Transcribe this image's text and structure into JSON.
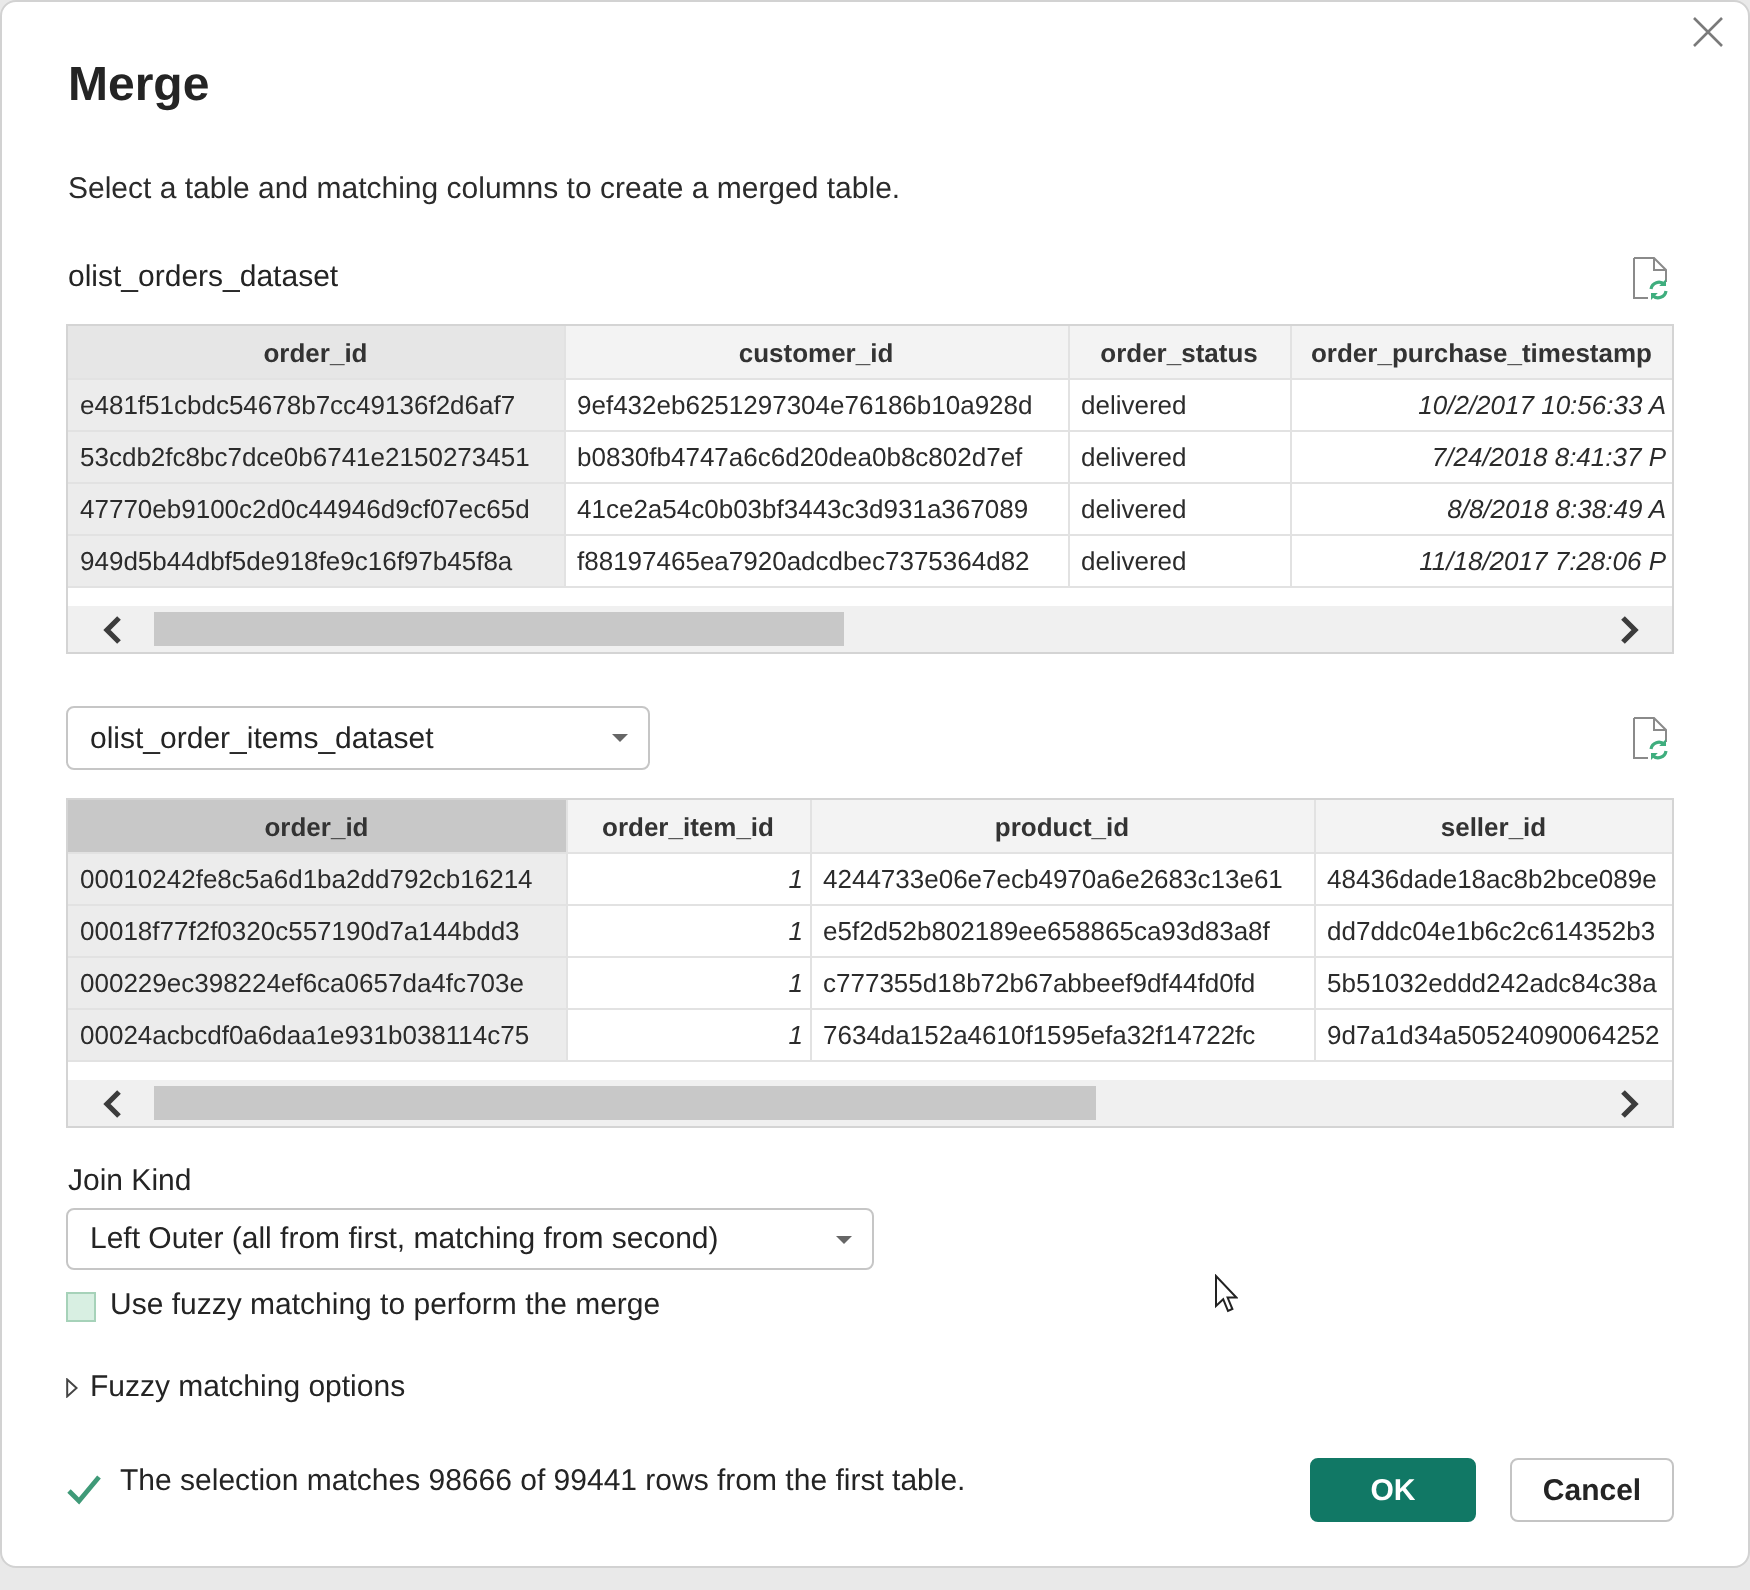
{
  "dialog": {
    "title": "Merge",
    "description": "Select a table and matching columns to create a merged table."
  },
  "tables": [
    {
      "source": {
        "kind": "label",
        "text": "olist_orders_dataset"
      },
      "focused": false,
      "columns": [
        {
          "label": "order_id",
          "kind": "text",
          "selected": true
        },
        {
          "label": "customer_id",
          "kind": "text",
          "selected": false
        },
        {
          "label": "order_status",
          "kind": "text",
          "selected": false
        },
        {
          "label": "order_purchase_timestamp",
          "kind": "number",
          "selected": false
        }
      ],
      "rows": [
        [
          "e481f51cbdc54678b7cc49136f2d6af7",
          "9ef432eb6251297304e76186b10a928d",
          "delivered",
          "10/2/2017 10:56:33 A"
        ],
        [
          "53cdb2fc8bc7dce0b6741e2150273451",
          "b0830fb4747a6c6d20dea0b8c802d7ef",
          "delivered",
          "7/24/2018 8:41:37 P"
        ],
        [
          "47770eb9100c2d0c44946d9cf07ec65d",
          "41ce2a54c0b03bf3443c3d931a367089",
          "delivered",
          "8/8/2018 8:38:49 A"
        ],
        [
          "949d5b44dbf5de918fe9c16f97b45f8a",
          "f88197465ea7920adcdbec7375364d82",
          "delivered",
          "11/18/2017 7:28:06 P"
        ]
      ]
    },
    {
      "source": {
        "kind": "dropdown",
        "text": "olist_order_items_dataset"
      },
      "focused": true,
      "columns": [
        {
          "label": "order_id",
          "kind": "text",
          "selected": true
        },
        {
          "label": "order_item_id",
          "kind": "number",
          "selected": false
        },
        {
          "label": "product_id",
          "kind": "text",
          "selected": false
        },
        {
          "label": "seller_id",
          "kind": "text",
          "selected": false
        }
      ],
      "rows": [
        [
          "00010242fe8c5a6d1ba2dd792cb16214",
          "1",
          "4244733e06e7ecb4970a6e2683c13e61",
          "48436dade18ac8b2bce089e"
        ],
        [
          "00018f77f2f0320c557190d7a144bdd3",
          "1",
          "e5f2d52b802189ee658865ca93d83a8f",
          "dd7ddc04e1b6c2c614352b3"
        ],
        [
          "000229ec398224ef6ca0657da4fc703e",
          "1",
          "c777355d18b72b67abbeef9df44fd0fd",
          "5b51032eddd242adc84c38a"
        ],
        [
          "00024acbcdf0a6daa1e931b038114c75",
          "1",
          "7634da152a4610f1595efa32f14722fc",
          "9d7a1d34a50524090064252"
        ]
      ]
    }
  ],
  "join_kind": {
    "label": "Join Kind",
    "value": "Left Outer (all from first, matching from second)"
  },
  "fuzzy_matching": {
    "label": "Use fuzzy matching to perform the merge",
    "checked": false
  },
  "fuzzy_options": {
    "label": "Fuzzy matching options",
    "expanded": false
  },
  "status": {
    "text": "The selection matches 98666 of 99441 rows from the first table."
  },
  "buttons": [
    {
      "label": "OK",
      "kind": "primary"
    },
    {
      "label": "Cancel",
      "kind": "secondary"
    }
  ]
}
